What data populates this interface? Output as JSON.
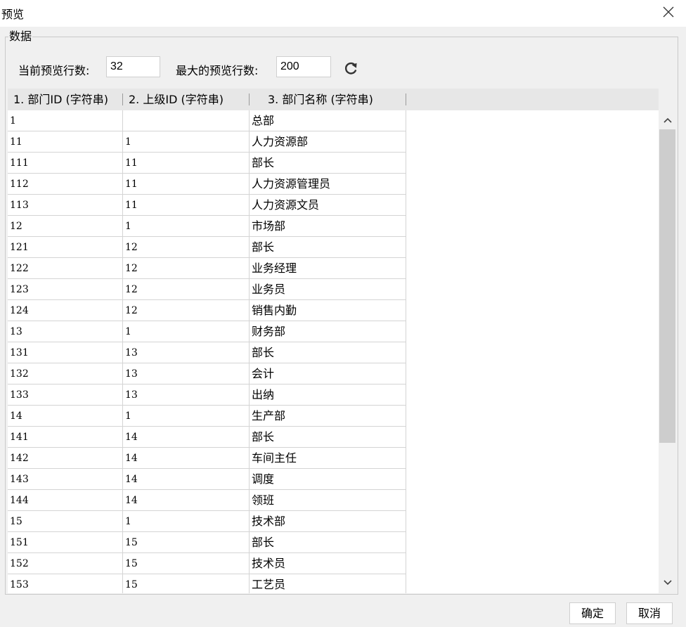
{
  "window": {
    "title": "预览",
    "close_icon": "close-icon"
  },
  "group": {
    "legend": "数据"
  },
  "controls": {
    "current_rows_label": "当前预览行数:",
    "current_rows_value": "32",
    "max_rows_label": "最大的预览行数:",
    "max_rows_value": "200",
    "refresh_icon": "refresh-icon"
  },
  "table": {
    "columns": [
      "1.  部门ID (字符串)",
      "2.  上级ID (字符串)",
      "3.  部门名称 (字符串)"
    ],
    "rows": [
      [
        "1",
        "",
        "总部"
      ],
      [
        "11",
        "1",
        "人力资源部"
      ],
      [
        "111",
        "11",
        "部长"
      ],
      [
        "112",
        "11",
        "人力资源管理员"
      ],
      [
        "113",
        "11",
        "人力资源文员"
      ],
      [
        "12",
        "1",
        "市场部"
      ],
      [
        "121",
        "12",
        "部长"
      ],
      [
        "122",
        "12",
        "业务经理"
      ],
      [
        "123",
        "12",
        "业务员"
      ],
      [
        "124",
        "12",
        "销售内勤"
      ],
      [
        "13",
        "1",
        "财务部"
      ],
      [
        "131",
        "13",
        "部长"
      ],
      [
        "132",
        "13",
        "会计"
      ],
      [
        "133",
        "13",
        "出纳"
      ],
      [
        "14",
        "1",
        "生产部"
      ],
      [
        "141",
        "14",
        "部长"
      ],
      [
        "142",
        "14",
        "车间主任"
      ],
      [
        "143",
        "14",
        "调度"
      ],
      [
        "144",
        "14",
        "领班"
      ],
      [
        "15",
        "1",
        "技术部"
      ],
      [
        "151",
        "15",
        "部长"
      ],
      [
        "152",
        "15",
        "技术员"
      ],
      [
        "153",
        "15",
        "工艺员"
      ]
    ]
  },
  "scrollbar": {
    "up_icon": "chevron-up-icon",
    "down_icon": "chevron-down-icon"
  },
  "buttons": {
    "ok": "确定",
    "cancel": "取消"
  }
}
